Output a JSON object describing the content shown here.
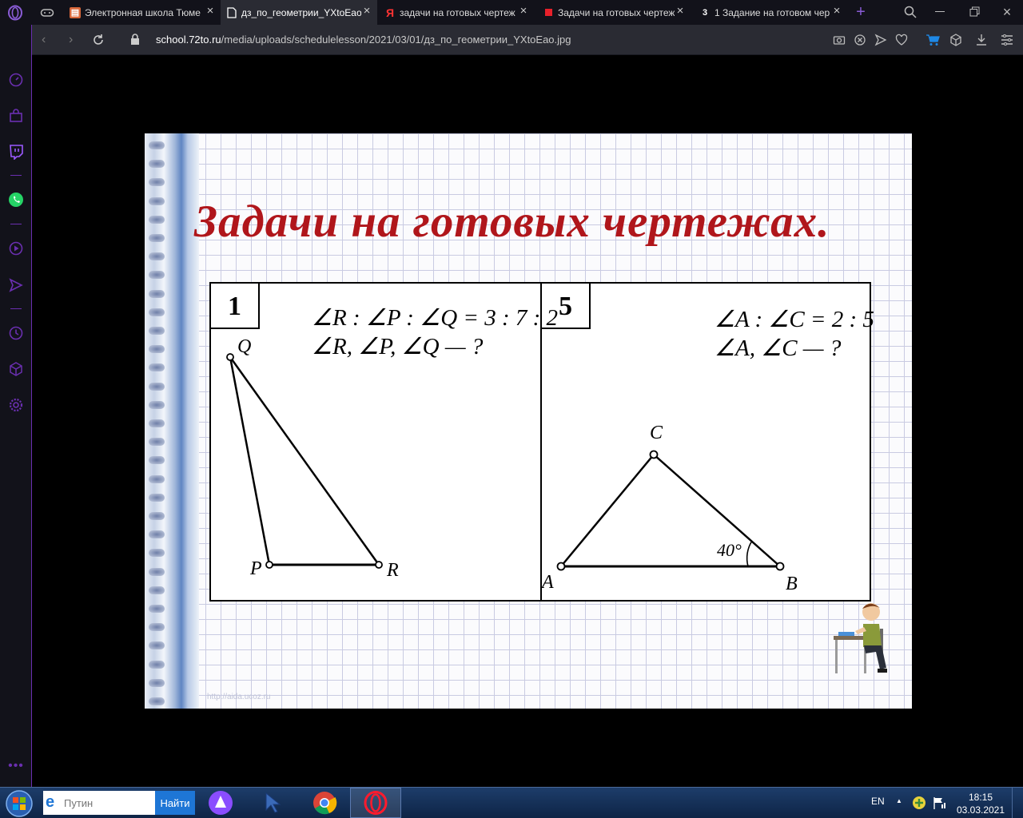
{
  "browser": {
    "tabs": [
      {
        "label": "Электронная школа Тюме",
        "icon": "school-favicon",
        "active": false
      },
      {
        "label": "дз_по_геометрии_YXtoEao",
        "icon": "document-favicon",
        "active": true
      },
      {
        "label": "задачи на готовых чертеж",
        "icon": "yandex-favicon",
        "active": false
      },
      {
        "label": "Задачи на готовых чертеж",
        "icon": "red-square-favicon",
        "active": false
      },
      {
        "label": "1 Задание на готовом чер",
        "icon": "z-favicon",
        "active": false
      }
    ],
    "yandex_letter": "Я",
    "z_letter": "3",
    "address": {
      "host": "school.72to.ru",
      "path": "/media/uploads/schedulelesson/2021/03/01/дз_по_геометрии_YXtoEao.jpg"
    }
  },
  "slide": {
    "title": "Задачи на готовых чертежах.",
    "watermark": "http://aida.ucoz.ru",
    "problem1": {
      "number": "1",
      "condition_line1": "∠R : ∠P : ∠Q = 3 : 7 : 2",
      "condition_line2": "∠R, ∠P, ∠Q — ?",
      "labels": {
        "q": "Q",
        "p": "P",
        "r": "R"
      }
    },
    "problem5": {
      "number": "5",
      "condition_line1": "∠A : ∠C = 2 : 5",
      "condition_line2": "∠A, ∠C — ?",
      "labels": {
        "a": "A",
        "b": "B",
        "c": "C"
      },
      "angle": "40°"
    }
  },
  "taskbar": {
    "search_placeholder": "Путин",
    "search_button": "Найти",
    "language": "EN",
    "time": "18:15",
    "date": "03.03.2021"
  },
  "colors": {
    "accent": "#6a2fb0",
    "slide_title": "#b0161b",
    "search_button": "#1e76d6"
  }
}
